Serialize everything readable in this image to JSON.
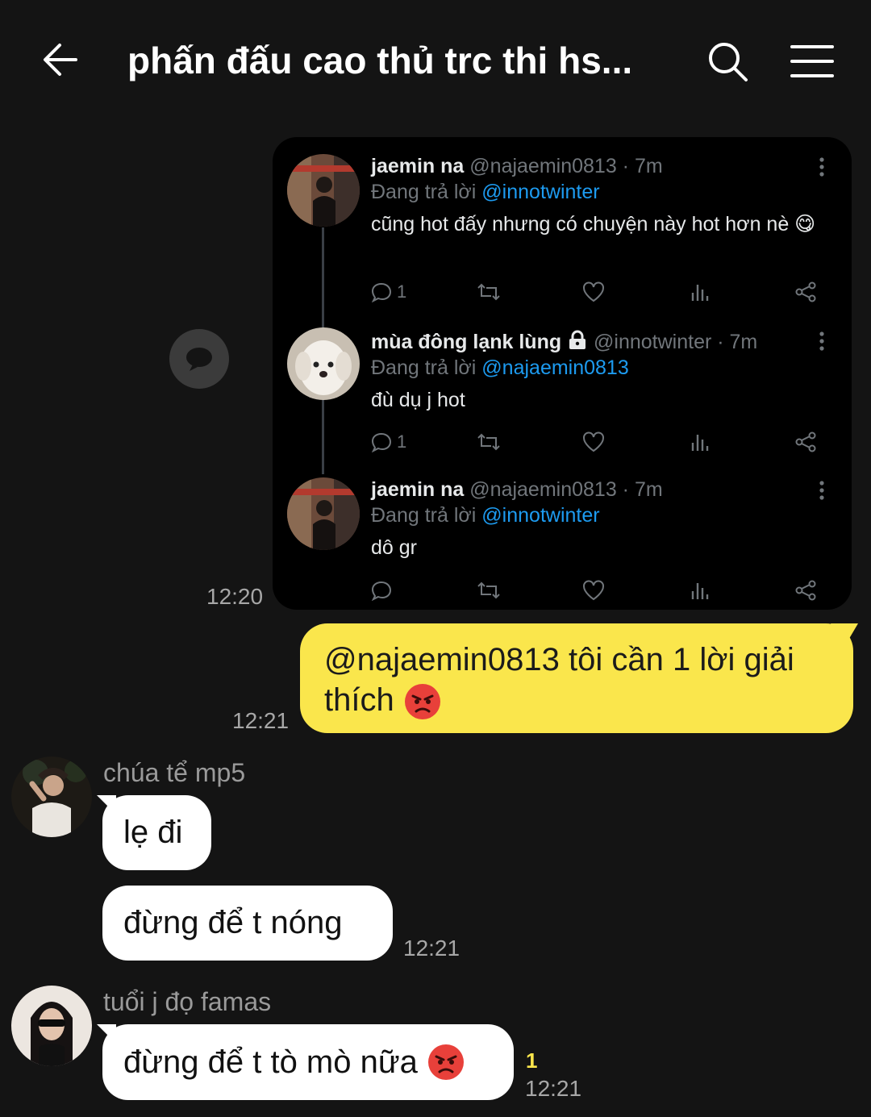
{
  "header": {
    "title": "phấn đấu cao thủ trc thi hs..."
  },
  "shared_tweets": [
    {
      "name": "jaemin na",
      "handle_time": "@najaemin0813 · 7m",
      "reply_prefix": "Đang trả lời",
      "reply_to": "@innotwinter",
      "text": "cũng hot đấy nhưng có chuyện này hot hơn nè 😋",
      "reply_count": "1"
    },
    {
      "name": "mùa đông lạnk lùng",
      "handle_time": "@innotwinter · 7m",
      "reply_prefix": "Đang trả lời",
      "reply_to": "@najaemin0813",
      "text": "đù dụ j hot",
      "reply_count": "1"
    },
    {
      "name": "jaemin na",
      "handle_time": "@najaemin0813 · 7m",
      "reply_prefix": "Đang trả lời",
      "reply_to": "@innotwinter",
      "text": "dô gr",
      "reply_count": ""
    }
  ],
  "messages": {
    "shared_time": "12:20",
    "mine": {
      "text": "@najaemin0813 tôi cần 1 lời giải thích",
      "time": "12:21"
    },
    "sender1": {
      "name": "chúa tể mp5",
      "msg1": "lẹ đi",
      "msg2": "đừng để t nóng",
      "time": "12:21"
    },
    "sender2": {
      "name": "tuổi j đọ famas",
      "msg1": "đừng để t tò mò nữa",
      "unread": "1",
      "time": "12:21"
    }
  },
  "colors": {
    "background": "#141414",
    "my_bubble": "#fae64c",
    "other_bubble": "#ffffff",
    "mention": "#1d9bf0",
    "unread": "#fae64c"
  },
  "icons": [
    "back-arrow-icon",
    "search-icon",
    "menu-icon",
    "share-icon",
    "reply-icon",
    "retweet-icon",
    "like-icon",
    "views-icon",
    "share-tweet-icon",
    "more-icon",
    "lock-icon",
    "angry-emoji",
    "yum-emoji"
  ]
}
